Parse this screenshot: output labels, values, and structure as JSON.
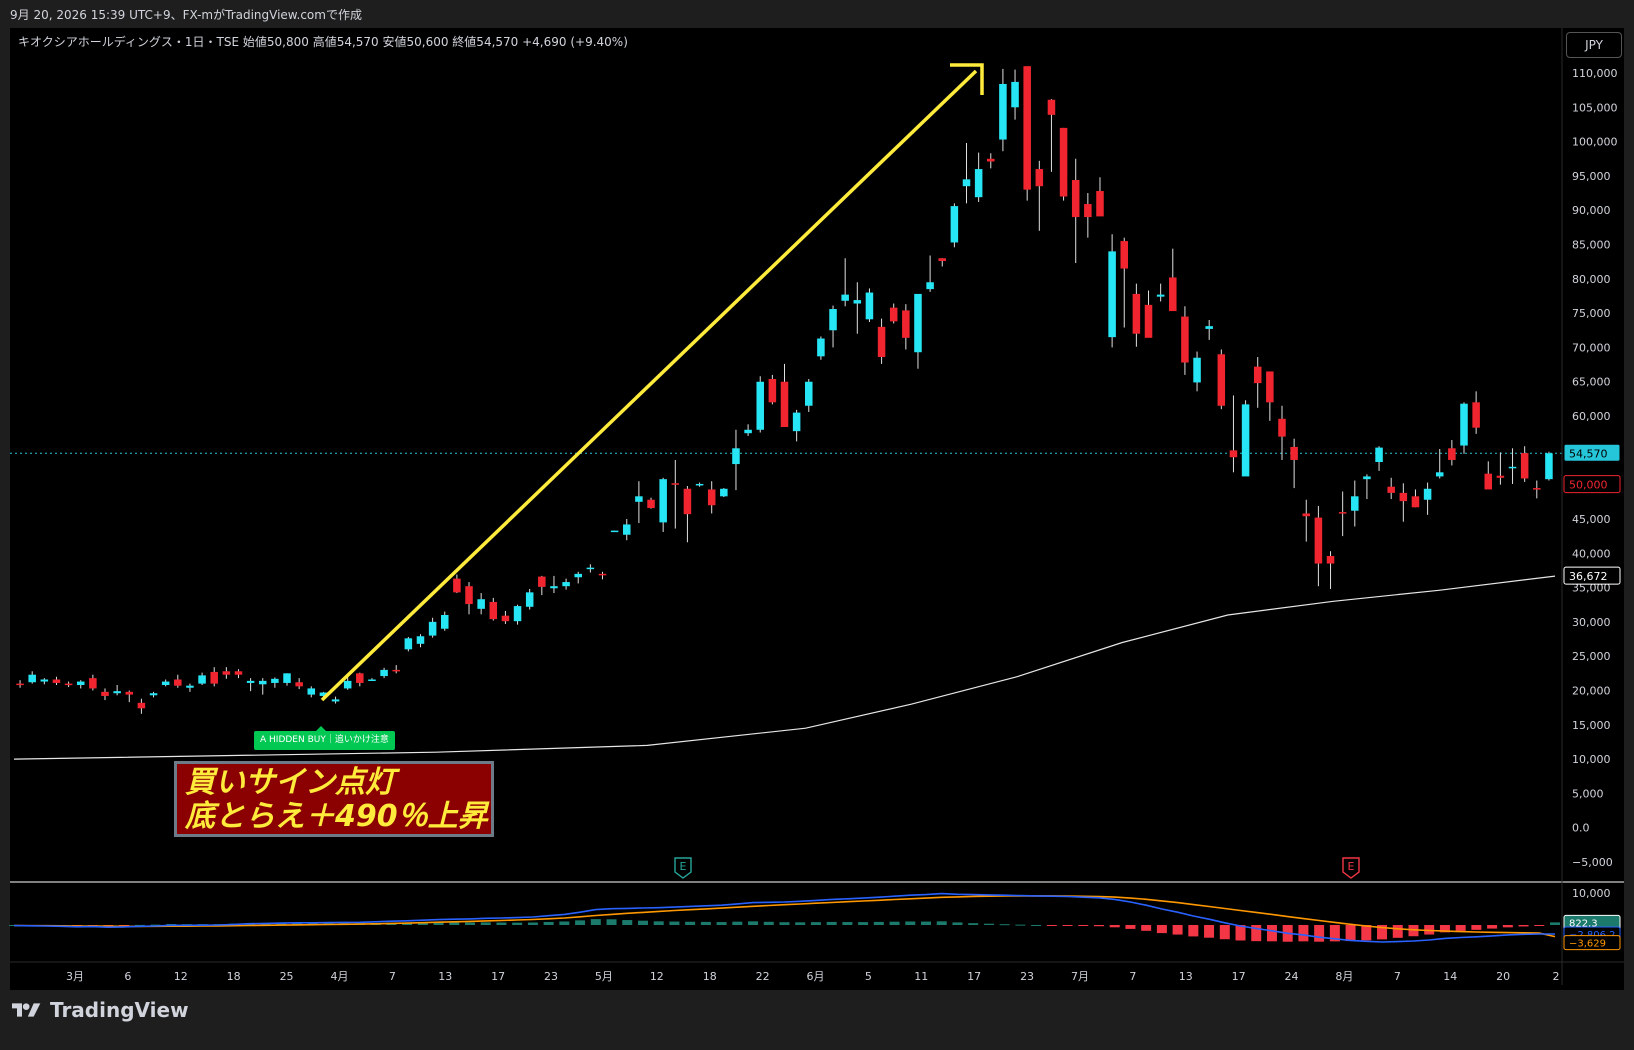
{
  "header": {
    "timestamp": "9月 20, 2026 15:39 UTC+9、FX-mがTradingView.comで作成"
  },
  "legend": {
    "symbol": "キオクシアホールディングス・1日・TSE",
    "open": "始値50,800",
    "high": "高値54,570",
    "low": "安値50,600",
    "close": "終値54,570",
    "change": "+4,690 (+9.40%)"
  },
  "currency_button": "JPY",
  "signal": {
    "label": "A HIDDEN BUY｜追いかけ注意"
  },
  "callout": {
    "line1": "買いサイン点灯",
    "line2": "底とらえ＋490％上昇"
  },
  "earnings_markers": [
    "E",
    "E"
  ],
  "footer": {
    "brand": "TradingView"
  },
  "colors": {
    "up": "#26e6f5",
    "down": "#f0252f",
    "arrow": "#ffeb3b",
    "ma": "#e6e6e6",
    "macd": "#2962ff",
    "signal": "#ff9800",
    "hist_pos": "#1b7a6b",
    "hist_neg": "#f23645"
  },
  "chart_data": {
    "type": "candlestick",
    "price_axis": [
      "110,000",
      "105,000",
      "100,000",
      "95,000",
      "90,000",
      "85,000",
      "80,000",
      "75,000",
      "70,000",
      "65,000",
      "60,000",
      "55,000",
      "50,000",
      "45,000",
      "40,000",
      "35,000",
      "30,000",
      "25,000",
      "20,000",
      "15,000",
      "10,000",
      "5,000",
      "0.0",
      "−5,000"
    ],
    "price_axis_values": [
      110000,
      105000,
      100000,
      95000,
      90000,
      85000,
      80000,
      75000,
      70000,
      65000,
      60000,
      55000,
      50000,
      45000,
      40000,
      35000,
      30000,
      25000,
      20000,
      15000,
      10000,
      5000,
      0,
      -5000
    ],
    "time_axis": [
      "3月",
      "6",
      "12",
      "18",
      "25",
      "4月",
      "7",
      "13",
      "17",
      "23",
      "5月",
      "12",
      "18",
      "22",
      "6月",
      "5",
      "11",
      "17",
      "23",
      "7月",
      "7",
      "13",
      "17",
      "24",
      "8月",
      "7",
      "14",
      "20",
      "2"
    ],
    "price_labels": {
      "last": "54,570",
      "level": "50,000",
      "ma_value": "36,672"
    },
    "ma_line": [
      [
        0,
        10000
      ],
      [
        40,
        11000
      ],
      [
        60,
        12000
      ],
      [
        75,
        14500
      ],
      [
        85,
        18000
      ],
      [
        95,
        22000
      ],
      [
        105,
        27000
      ],
      [
        115,
        31000
      ],
      [
        125,
        33000
      ],
      [
        135,
        34600
      ],
      [
        146,
        36672
      ]
    ],
    "candles": [
      [
        21000,
        21500,
        20400,
        20800
      ],
      [
        21200,
        22800,
        21000,
        22300
      ],
      [
        21300,
        21800,
        20900,
        21600
      ],
      [
        21600,
        22000,
        20800,
        21100
      ],
      [
        21000,
        21300,
        20500,
        20800
      ],
      [
        20800,
        21500,
        20300,
        21300
      ],
      [
        21800,
        22300,
        20000,
        20300
      ],
      [
        19800,
        20300,
        18600,
        19200
      ],
      [
        19600,
        20800,
        19300,
        19900
      ],
      [
        19800,
        20000,
        18300,
        19400
      ],
      [
        18200,
        18800,
        16600,
        17400
      ],
      [
        19300,
        19800,
        19000,
        19600
      ],
      [
        20800,
        21600,
        20600,
        21300
      ],
      [
        21600,
        22300,
        20400,
        20700
      ],
      [
        20400,
        21000,
        19800,
        20700
      ],
      [
        21000,
        22600,
        20800,
        22200
      ],
      [
        22700,
        23400,
        20600,
        21000
      ],
      [
        22800,
        23400,
        21700,
        22300
      ],
      [
        22800,
        23100,
        21800,
        22300
      ],
      [
        21100,
        21800,
        19900,
        21400
      ],
      [
        20900,
        21800,
        19400,
        21400
      ],
      [
        21100,
        21900,
        20400,
        21700
      ],
      [
        21100,
        22500,
        20700,
        22500
      ],
      [
        21200,
        21800,
        20200,
        20600
      ],
      [
        19400,
        20600,
        19000,
        20300
      ],
      [
        19200,
        19800,
        18600,
        19700
      ],
      [
        18400,
        19100,
        18100,
        18700
      ],
      [
        20300,
        21900,
        20100,
        21400
      ],
      [
        22500,
        22600,
        20600,
        21100
      ],
      [
        21600,
        21800,
        21400,
        21600
      ],
      [
        22100,
        23300,
        21800,
        23000
      ],
      [
        23000,
        23700,
        22500,
        22900
      ],
      [
        26000,
        27800,
        25700,
        27600
      ],
      [
        26800,
        28200,
        26300,
        27900
      ],
      [
        28000,
        30600,
        27700,
        30000
      ],
      [
        29000,
        31500,
        28700,
        31000
      ],
      [
        36300,
        36900,
        34200,
        34300
      ],
      [
        35200,
        35800,
        31100,
        32600
      ],
      [
        31900,
        34200,
        31100,
        33300
      ],
      [
        32900,
        33500,
        30200,
        30400
      ],
      [
        30900,
        31600,
        29700,
        30100
      ],
      [
        30100,
        32500,
        29600,
        32300
      ],
      [
        32200,
        34800,
        31800,
        34300
      ],
      [
        36600,
        36700,
        33900,
        35100
      ],
      [
        34900,
        36700,
        34200,
        35200
      ],
      [
        35200,
        36300,
        34700,
        35800
      ],
      [
        36500,
        37300,
        35600,
        37000
      ],
      [
        37700,
        38400,
        37200,
        37900
      ],
      [
        37000,
        37300,
        36200,
        36800
      ],
      [
        43300,
        43300,
        43100,
        43300
      ],
      [
        42700,
        45000,
        41900,
        44200
      ],
      [
        47500,
        50500,
        44400,
        48300
      ],
      [
        47800,
        48100,
        46500,
        46600
      ],
      [
        44500,
        51000,
        43100,
        50800
      ],
      [
        50200,
        53600,
        43600,
        50100
      ],
      [
        49400,
        49800,
        41600,
        45700
      ],
      [
        49900,
        50300,
        49700,
        50100
      ],
      [
        49300,
        50500,
        45800,
        47000
      ],
      [
        48300,
        49500,
        48200,
        49400
      ],
      [
        53000,
        58000,
        49200,
        55300
      ],
      [
        57500,
        58800,
        57100,
        58000
      ],
      [
        58000,
        65800,
        57600,
        65000
      ],
      [
        65400,
        66000,
        61700,
        62000
      ],
      [
        65000,
        67600,
        59000,
        58400
      ],
      [
        57800,
        60900,
        56300,
        60500
      ],
      [
        61500,
        65400,
        60600,
        65000
      ],
      [
        68700,
        71600,
        68200,
        71300
      ],
      [
        72500,
        76100,
        70000,
        75600
      ],
      [
        76800,
        83000,
        76000,
        77700
      ],
      [
        76400,
        79500,
        72000,
        76900
      ],
      [
        74100,
        78600,
        73700,
        78000
      ],
      [
        73000,
        74200,
        67600,
        68600
      ],
      [
        75800,
        76400,
        73500,
        73800
      ],
      [
        75400,
        76300,
        69700,
        71400
      ],
      [
        69300,
        77500,
        66900,
        77800
      ],
      [
        78500,
        83400,
        78100,
        79500
      ],
      [
        83000,
        83000,
        81800,
        82600
      ],
      [
        85300,
        91000,
        84600,
        90600
      ],
      [
        93500,
        99800,
        91000,
        94500
      ],
      [
        91900,
        98400,
        91200,
        96000
      ],
      [
        97500,
        98300,
        96100,
        97100
      ],
      [
        100300,
        110600,
        98600,
        108400
      ],
      [
        105000,
        110500,
        103200,
        108700
      ],
      [
        111000,
        110600,
        91400,
        93000
      ],
      [
        96000,
        97200,
        87000,
        93500
      ],
      [
        106100,
        106200,
        95600,
        103900
      ],
      [
        102000,
        102000,
        91400,
        92000
      ],
      [
        94400,
        97500,
        82300,
        89000
      ],
      [
        90900,
        92500,
        86000,
        89000
      ],
      [
        92800,
        94800,
        90000,
        89100
      ],
      [
        71500,
        86500,
        70000,
        84000
      ],
      [
        85500,
        86000,
        72900,
        81500
      ],
      [
        77800,
        79300,
        70100,
        72000
      ],
      [
        76200,
        78300,
        72100,
        71400
      ],
      [
        77400,
        79300,
        76700,
        77700
      ],
      [
        80200,
        84400,
        76400,
        75300
      ],
      [
        74500,
        76000,
        66000,
        67800
      ],
      [
        64900,
        69400,
        63600,
        68500
      ],
      [
        72700,
        74000,
        71100,
        73100
      ],
      [
        69000,
        69700,
        61000,
        61500
      ],
      [
        55000,
        63000,
        51800,
        54000
      ],
      [
        51200,
        62300,
        53700,
        61700
      ],
      [
        67200,
        68600,
        61200,
        64800
      ],
      [
        66500,
        66500,
        59300,
        62000
      ],
      [
        59600,
        61500,
        53600,
        57000
      ],
      [
        55500,
        56700,
        49500,
        53600
      ],
      [
        45800,
        47800,
        41700,
        45400
      ],
      [
        45200,
        46900,
        35200,
        38500
      ],
      [
        39600,
        40300,
        34800,
        38500
      ],
      [
        46000,
        49000,
        42500,
        45800
      ],
      [
        46200,
        50600,
        43900,
        48300
      ],
      [
        50800,
        51500,
        47900,
        51200
      ],
      [
        53300,
        55600,
        52000,
        55400
      ],
      [
        49700,
        51000,
        47900,
        48800
      ],
      [
        48800,
        50200,
        44600,
        47600
      ],
      [
        48300,
        49300,
        46700,
        46700
      ],
      [
        47800,
        50300,
        45600,
        49400
      ],
      [
        51200,
        55200,
        50900,
        51800
      ],
      [
        55300,
        56500,
        52800,
        53600
      ],
      [
        55700,
        62000,
        54500,
        61800
      ],
      [
        62000,
        63600,
        57400,
        58300
      ],
      [
        51600,
        53400,
        49800,
        49300
      ],
      [
        51300,
        54700,
        50000,
        51000
      ],
      [
        52500,
        55300,
        50100,
        52600
      ],
      [
        54600,
        55600,
        50400,
        50900
      ],
      [
        49500,
        50600,
        48000,
        49400
      ],
      [
        50800,
        54800,
        50600,
        54570
      ]
    ],
    "macd": {
      "macd_line": [
        -200,
        -260,
        -300,
        -400,
        -550,
        -500,
        -700,
        -600,
        -400,
        -300,
        -80,
        -100,
        -50,
        0,
        200,
        400,
        500,
        600,
        680,
        700,
        750,
        800,
        850,
        1000,
        1200,
        1300,
        1500,
        1700,
        1800,
        1900,
        2100,
        2200,
        2300,
        2500,
        2900,
        3300,
        4000,
        4800,
        5100,
        5200,
        5300,
        5400,
        5600,
        5800,
        6000,
        6200,
        6600,
        7000,
        7100,
        7200,
        7400,
        7700,
        8000,
        8200,
        8400,
        8700,
        9000,
        9300,
        9500,
        9800,
        9600,
        9500,
        9400,
        9300,
        9200,
        9100,
        9000,
        8900,
        8700,
        8500,
        8000,
        7200,
        6200,
        5000,
        4000,
        2800,
        1800,
        700,
        -300,
        -1100,
        -1800,
        -2600,
        -3100,
        -3800,
        -4300,
        -4800,
        -5100,
        -5300,
        -5200,
        -5000,
        -4700,
        -4200,
        -3900,
        -3700,
        -3400,
        -3100,
        -2900,
        -2800,
        -2806.2
      ],
      "signal_line": [
        -200,
        -210,
        -230,
        -260,
        -300,
        -340,
        -390,
        -420,
        -430,
        -420,
        -390,
        -360,
        -320,
        -280,
        -220,
        -150,
        -90,
        -30,
        30,
        90,
        150,
        210,
        280,
        380,
        500,
        600,
        720,
        860,
        1000,
        1130,
        1280,
        1420,
        1560,
        1720,
        1950,
        2200,
        2550,
        2960,
        3320,
        3650,
        3950,
        4250,
        4520,
        4780,
        5030,
        5280,
        5560,
        5850,
        6100,
        6330,
        6560,
        6800,
        7040,
        7270,
        7490,
        7730,
        7970,
        8200,
        8420,
        8650,
        8790,
        8930,
        9000,
        9050,
        9080,
        9090,
        9080,
        9030,
        8970,
        8880,
        8720,
        8420,
        8020,
        7530,
        6990,
        6370,
        5770,
        5150,
        4540,
        3950,
        3300,
        2630,
        2010,
        1420,
        820,
        230,
        -310,
        -800,
        -1190,
        -1490,
        -1720,
        -1900,
        -2060,
        -2180,
        -2280,
        -2370,
        -2450,
        -2530,
        -3629
      ],
      "labels": [
        "822.3",
        "−2,806.2",
        "−3,629"
      ],
      "axis": [
        "10,000"
      ]
    }
  }
}
